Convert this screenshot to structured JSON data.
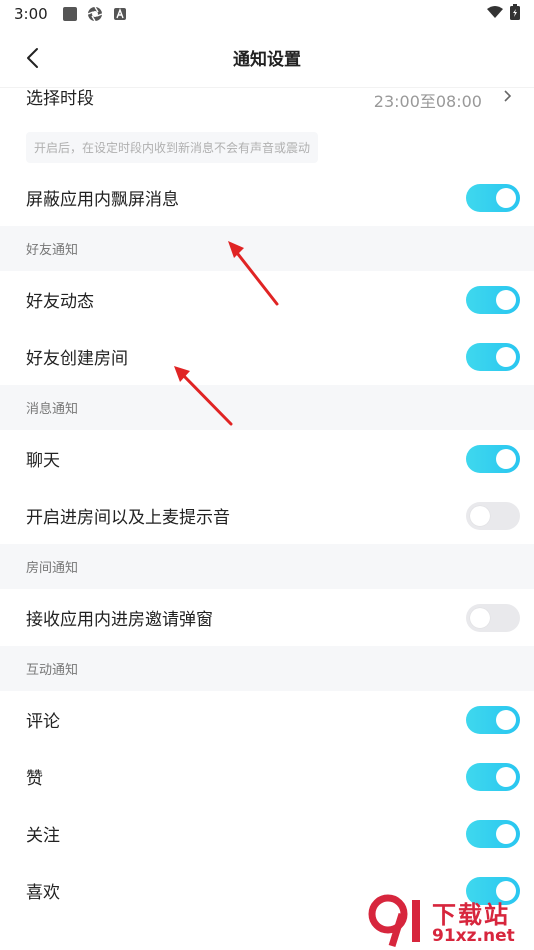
{
  "status_bar": {
    "time": "3:00"
  },
  "header": {
    "title": "通知设置"
  },
  "dnd": {
    "time_range_label": "选择时段",
    "time_range_value": "23:00至08:00",
    "hint": "开启后，在设定时段内收到新消息不会有声音或震动",
    "block_float_label": "屏蔽应用内飘屏消息",
    "block_float_on": true
  },
  "sections": {
    "friend": {
      "header": "好友通知",
      "items": [
        {
          "label": "好友动态",
          "on": true
        },
        {
          "label": "好友创建房间",
          "on": true
        }
      ]
    },
    "message": {
      "header": "消息通知",
      "items": [
        {
          "label": "聊天",
          "on": true
        },
        {
          "label": "开启进房间以及上麦提示音",
          "on": false
        }
      ]
    },
    "room": {
      "header": "房间通知",
      "items": [
        {
          "label": "接收应用内进房邀请弹窗",
          "on": false
        }
      ]
    },
    "interaction": {
      "header": "互动通知",
      "items": [
        {
          "label": "评论",
          "on": true
        },
        {
          "label": "赞",
          "on": true
        },
        {
          "label": "关注",
          "on": true
        },
        {
          "label": "喜欢",
          "on": true
        }
      ]
    }
  },
  "watermark": {
    "top": "下载站",
    "bottom": "91xz.net"
  },
  "colors": {
    "toggle_on": "#2fcdee",
    "toggle_off": "#e9e9ec",
    "section_bg": "#f6f7f9",
    "annotation_arrow": "#e02424"
  }
}
